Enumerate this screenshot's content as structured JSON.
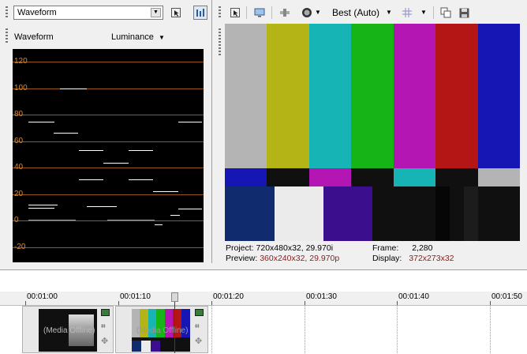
{
  "scope_panel": {
    "scope_type": "Waveform",
    "scope_label": "Waveform",
    "channel": "Luminance",
    "y_ticks": [
      "120",
      "100",
      "80",
      "60",
      "40",
      "20",
      "0",
      "-20"
    ]
  },
  "preview_panel": {
    "quality": "Best (Auto)",
    "project_label": "Project:",
    "project_value": "720x480x32, 29.970i",
    "preview_label": "Preview:",
    "preview_value": "360x240x32, 29.970p",
    "frame_label": "Frame:",
    "frame_value": "2,280",
    "display_label": "Display:",
    "display_value": "372x273x32"
  },
  "timeline": {
    "ruler_labels": [
      "00:01:00",
      "00:01:10",
      "00:01:20",
      "00:01:30",
      "00:01:40",
      "00:01:50"
    ],
    "clips": [
      {
        "label": "(Media Offline)"
      },
      {
        "label": "(Media Offline)"
      }
    ]
  },
  "colors": {
    "scope_grid": "#b4661e",
    "scope_label": "#d98a3a",
    "highlight_value": "#8b1a1a",
    "playhead": "#cc0000"
  },
  "icons": [
    "dropdown-arrow-icon",
    "pointer-select-icon",
    "scope-bars-icon",
    "monitor-icon",
    "split-screen-icon",
    "overlay-icon",
    "grid-icon",
    "copy-snapshot-icon",
    "save-snapshot-icon"
  ]
}
